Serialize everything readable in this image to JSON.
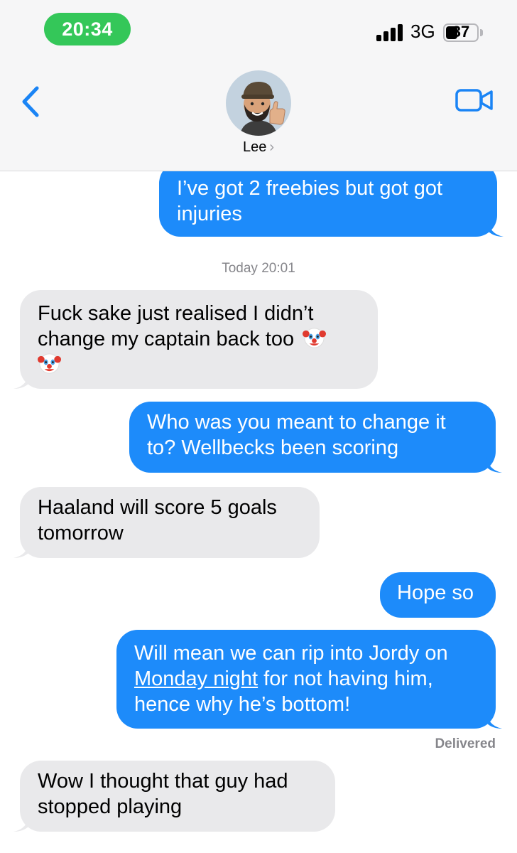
{
  "status_bar": {
    "time": "20:34",
    "network": "3G",
    "battery": "37"
  },
  "header": {
    "back_icon": "chevron-left-icon",
    "video_icon": "video-camera-icon",
    "contact_name": "Lee",
    "contact_chevron": "›",
    "avatar_icon": "memoji-thumbs-up-avatar"
  },
  "colors": {
    "outgoing_bubble": "#1d8bfa",
    "incoming_bubble": "#e9e9eb",
    "time_pill": "#34c759",
    "accent": "#1a84f5"
  },
  "conversation": {
    "timestamp_label": "Today 20:01",
    "delivered_label": "Delivered",
    "messages": [
      {
        "direction": "out",
        "line1": "I’ve got 2 freebies but got got",
        "line2": "injuries"
      },
      {
        "direction": "in",
        "line1": "Fuck sake just realised I didn’t",
        "line2": "change my captain back too",
        "emoji": "clown-face-emoji"
      },
      {
        "direction": "out",
        "line1": "Who was you meant to change it",
        "line2": "to? Wellbecks been scoring"
      },
      {
        "direction": "in",
        "line1": "Haaland will score 5 goals",
        "line2": "tomorrow"
      },
      {
        "direction": "out",
        "line1": "Hope so"
      },
      {
        "direction": "out",
        "line1": "Will mean we can rip into Jordy on",
        "link": "Monday night",
        "line2_rest": " for not having him,",
        "line3": "hence why he’s bottom!"
      },
      {
        "direction": "in",
        "line1": "Wow I thought that guy had",
        "line2": "stopped playing"
      }
    ]
  }
}
